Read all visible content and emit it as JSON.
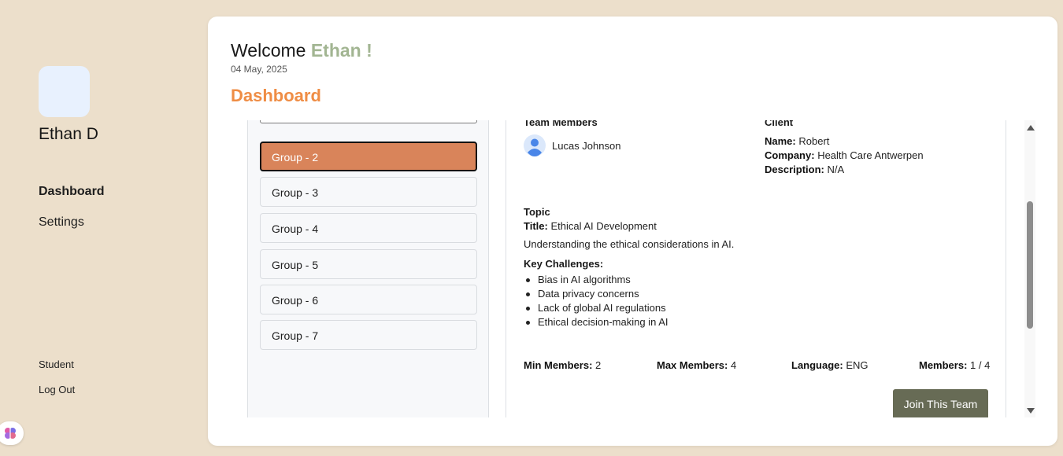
{
  "sidebar": {
    "user_name": "Ethan D",
    "nav": [
      {
        "label": "Dashboard",
        "active": true
      },
      {
        "label": "Settings",
        "active": false
      }
    ],
    "role": "Student",
    "logout_label": "Log Out"
  },
  "header": {
    "welcome_prefix": "Welcome ",
    "welcome_name": "Ethan !",
    "date": "04 May, 2025",
    "page_title": "Dashboard"
  },
  "groups": {
    "items": [
      "Group - 2",
      "Group - 3",
      "Group - 4",
      "Group - 5",
      "Group - 6",
      "Group - 7"
    ],
    "selected": "Group - 2"
  },
  "detail": {
    "team_members_heading": "Team Members",
    "members": [
      "Lucas Johnson"
    ],
    "client_heading": "Client",
    "client": {
      "name_label": "Name:",
      "name": "Robert",
      "company_label": "Company:",
      "company": "Health Care Antwerpen",
      "description_label": "Description:",
      "description": "N/A"
    },
    "topic_heading": "Topic",
    "title_label": "Title:",
    "title": "Ethical AI Development",
    "summary": "Understanding the ethical considerations in AI.",
    "challenges_heading": "Key Challenges:",
    "challenges": [
      "Bias in AI algorithms",
      "Data privacy concerns",
      "Lack of global AI regulations",
      "Ethical decision-making in AI"
    ],
    "stats": {
      "min_label": "Min Members:",
      "min": "2",
      "max_label": "Max Members:",
      "max": "4",
      "language_label": "Language:",
      "language": "ENG",
      "members_label": "Members:",
      "members": "1 / 4"
    },
    "join_label": "Join This Team"
  },
  "colors": {
    "background": "#ecdfcb",
    "accent_name": "#a2b592",
    "dashboard_title": "#ef8d45",
    "selected_group": "#d9845a",
    "join_button": "#676b55"
  }
}
